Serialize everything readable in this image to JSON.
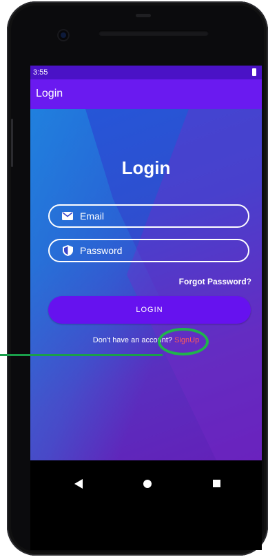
{
  "status_bar": {
    "time": "3:55",
    "battery_icon": "battery-icon"
  },
  "app_bar": {
    "title": "Login"
  },
  "login": {
    "title": "Login",
    "email_field": {
      "placeholder": "Email",
      "icon": "email-icon"
    },
    "password_field": {
      "placeholder": "Password",
      "icon": "shield-icon"
    },
    "forgot_password": "Forgot Password?",
    "login_button": "LOGIN",
    "signup_prompt": "Don't have an account?",
    "signup_link": "SignUp"
  },
  "nav_bar": {
    "icons": [
      "back-icon",
      "home-icon",
      "recent-apps-icon"
    ]
  },
  "annotation": {
    "color": "#20b34c"
  },
  "colors": {
    "status_bar": "#4a12c6",
    "app_bar": "#6a1af0",
    "button": "#6612ef",
    "signup_link": "#ff5a5a"
  }
}
